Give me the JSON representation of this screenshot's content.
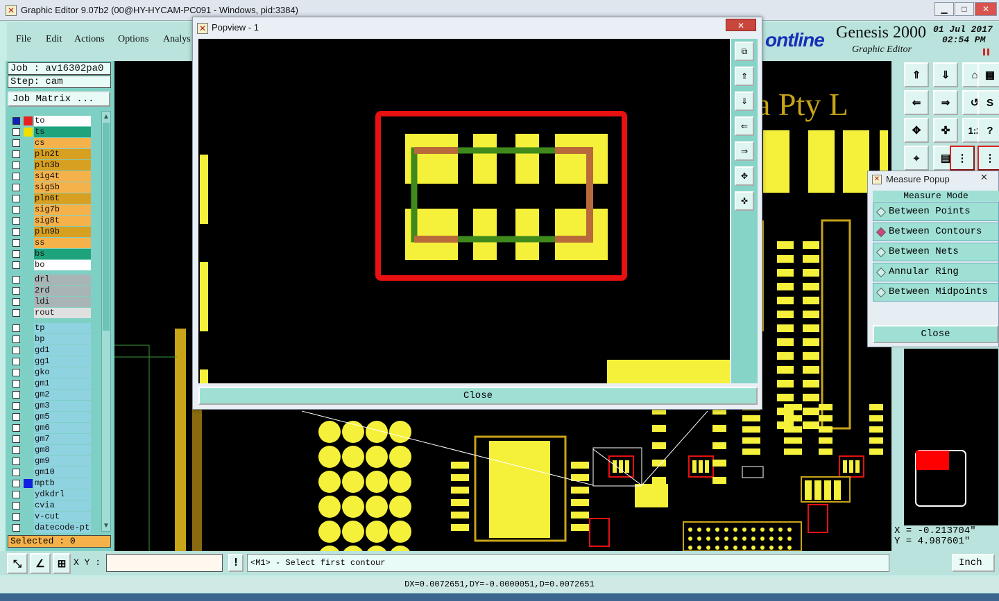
{
  "window": {
    "title": "Graphic Editor 9.07b2 (00@HY-HYCAM-PC091 - Windows, pid:3384)"
  },
  "menu": {
    "file": "File",
    "edit": "Edit",
    "actions": "Actions",
    "options": "Options",
    "analysis": "Analys"
  },
  "brand": {
    "logo": "ontline",
    "product": "Genesis 2000",
    "subtitle": "Graphic Editor",
    "date": "01 Jul 2017",
    "time": "02:54 PM"
  },
  "job": {
    "job_label": "Job : av16302pa0",
    "step_label": "Step: cam",
    "matrix_button": "Job Matrix ..."
  },
  "layers_group1": [
    {
      "name": "to",
      "bg": "#ffffff",
      "swatch": "#e82020"
    },
    {
      "name": "ts",
      "bg": "#1fa37c",
      "swatch": "#f0e000"
    },
    {
      "name": "cs",
      "bg": "#f6b24a",
      "swatch": ""
    },
    {
      "name": "pln2t",
      "bg": "#d8a020",
      "swatch": ""
    },
    {
      "name": "pln3b",
      "bg": "#d8a020",
      "swatch": ""
    },
    {
      "name": "sig4t",
      "bg": "#f6b24a",
      "swatch": ""
    },
    {
      "name": "sig5b",
      "bg": "#f6b24a",
      "swatch": ""
    },
    {
      "name": "pln6t",
      "bg": "#d8a020",
      "swatch": ""
    },
    {
      "name": "sig7b",
      "bg": "#f6b24a",
      "swatch": ""
    },
    {
      "name": "sig8t",
      "bg": "#f6b24a",
      "swatch": ""
    },
    {
      "name": "pln9b",
      "bg": "#d8a020",
      "swatch": ""
    },
    {
      "name": "ss",
      "bg": "#f6b24a",
      "swatch": ""
    },
    {
      "name": "bs",
      "bg": "#1fa37c",
      "swatch": ""
    },
    {
      "name": "bo",
      "bg": "#ffffff",
      "swatch": ""
    }
  ],
  "layers_group2": [
    {
      "name": "drl",
      "bg": "#a9b4b6",
      "swatch": ""
    },
    {
      "name": "2rd",
      "bg": "#a9b4b6",
      "swatch": ""
    },
    {
      "name": "ldi",
      "bg": "#a9b4b6",
      "swatch": ""
    },
    {
      "name": "rout",
      "bg": "#e0e0e0",
      "swatch": ""
    }
  ],
  "layers_group3": [
    {
      "name": "tp",
      "bg": "#8fd3e0",
      "swatch": ""
    },
    {
      "name": "bp",
      "bg": "#8fd3e0",
      "swatch": ""
    },
    {
      "name": "gd1",
      "bg": "#8fd3e0",
      "swatch": ""
    },
    {
      "name": "gg1",
      "bg": "#8fd3e0",
      "swatch": ""
    },
    {
      "name": "gko",
      "bg": "#8fd3e0",
      "swatch": ""
    },
    {
      "name": "gm1",
      "bg": "#8fd3e0",
      "swatch": ""
    },
    {
      "name": "gm2",
      "bg": "#8fd3e0",
      "swatch": ""
    },
    {
      "name": "gm3",
      "bg": "#8fd3e0",
      "swatch": ""
    },
    {
      "name": "gm5",
      "bg": "#8fd3e0",
      "swatch": ""
    },
    {
      "name": "gm6",
      "bg": "#8fd3e0",
      "swatch": ""
    },
    {
      "name": "gm7",
      "bg": "#8fd3e0",
      "swatch": ""
    },
    {
      "name": "gm8",
      "bg": "#8fd3e0",
      "swatch": ""
    },
    {
      "name": "gm9",
      "bg": "#8fd3e0",
      "swatch": ""
    },
    {
      "name": "gm10",
      "bg": "#8fd3e0",
      "swatch": ""
    },
    {
      "name": "mptb",
      "bg": "#8fd3e0",
      "swatch": "#1020e0"
    },
    {
      "name": "ydkdrl",
      "bg": "#8fd3e0",
      "swatch": ""
    },
    {
      "name": "cvia",
      "bg": "#8fd3e0",
      "swatch": ""
    },
    {
      "name": "v-cut",
      "bg": "#8fd3e0",
      "swatch": ""
    },
    {
      "name": "datecode-pt",
      "bg": "#8fd3e0",
      "swatch": ""
    }
  ],
  "selected": "Selected : 0",
  "board_text": "a Pty L",
  "popview": {
    "title": "Popview - 1",
    "close": "Close"
  },
  "measure": {
    "title": "Measure Popup",
    "header": "Measure Mode",
    "options": [
      "Between Points",
      "Between Contours",
      "Between Nets",
      "Annular Ring",
      "Between Midpoints"
    ],
    "selected_index": 1,
    "close": "Close"
  },
  "toolbar": {
    "scale_label": "1:2"
  },
  "coords": {
    "x": "X = -0.213704\"",
    "y": "Y =  4.987601\""
  },
  "bottom": {
    "xy_label": "X Y :",
    "xy_value": "",
    "prompt": "<M1> - Select first contour",
    "unit": "Inch"
  },
  "status": "DX=0.0072651,DY=-0.0000051,D=0.0072651",
  "colors": {
    "pad": "#f5f03a",
    "copper": "#c8a418",
    "highlight": "#e81010",
    "panel": "#b9e3dc"
  }
}
